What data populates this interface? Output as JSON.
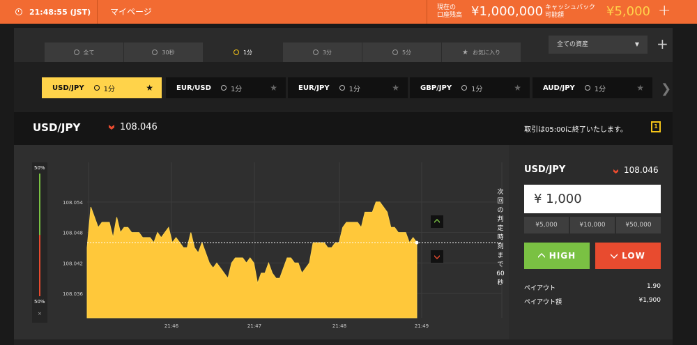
{
  "topbar": {
    "time": "21:48:55 (JST)",
    "mypage": "マイページ",
    "balance_label_line1": "現在の",
    "balance_label_line2": "口座残高",
    "balance_value": "¥1,000,000",
    "cashback_label_line1": "キャッシュバック",
    "cashback_label_line2": "可能額",
    "cashback_value": "¥5,000",
    "plus": "+"
  },
  "tabs": [
    {
      "label": "全て",
      "icon": "clock-icon"
    },
    {
      "label": "30秒",
      "icon": "clock-icon"
    },
    {
      "label": "1分",
      "icon": "clock-icon",
      "active": true
    },
    {
      "label": "3分",
      "icon": "clock-icon"
    },
    {
      "label": "5分",
      "icon": "clock-icon"
    },
    {
      "label": "お気に入り",
      "icon": "star-icon"
    }
  ],
  "asset_select": {
    "value": "全ての資産",
    "plus": "+"
  },
  "assets": [
    {
      "pair": "USD/JPY",
      "duration": "1分",
      "active": true
    },
    {
      "pair": "EUR/USD",
      "duration": "1分"
    },
    {
      "pair": "EUR/JPY",
      "duration": "1分"
    },
    {
      "pair": "GBP/JPY",
      "duration": "1分"
    },
    {
      "pair": "AUD/JPY",
      "duration": "1分"
    }
  ],
  "price_header": {
    "pair": "USD/JPY",
    "price": "108.046",
    "note": "取引は05:00に終了いたします。",
    "icon_label": "1"
  },
  "gauge": {
    "top": "50%",
    "bottom": "50%",
    "close": "×"
  },
  "chart_side_note": "次回の判定時刻まで60秒",
  "colors": {
    "accent": "#f26b32",
    "gold": "#ffd34a",
    "high": "#7ac143",
    "low": "#e84b2f"
  },
  "chart_data": {
    "type": "area",
    "y_ticks": [
      "108.054",
      "108.048",
      "108.042",
      "108.036"
    ],
    "x_ticks": [
      "21:46",
      "21:47",
      "21:48",
      "21:49"
    ],
    "ylim": [
      108.0312,
      108.0618
    ],
    "strike": 108.046,
    "series": [
      {
        "values": [
          108.045,
          108.053,
          108.051,
          108.049,
          108.05,
          108.05,
          108.05,
          108.047,
          108.051,
          108.048,
          108.049,
          108.049,
          108.048,
          108.048,
          108.048,
          108.047,
          108.047,
          108.047,
          108.046,
          108.048,
          108.047,
          108.048,
          108.049,
          108.046,
          108.047,
          108.046,
          108.045,
          108.045,
          108.048,
          108.045,
          108.044,
          108.046,
          108.044,
          108.042,
          108.041,
          108.042,
          108.041,
          108.04,
          108.039,
          108.042,
          108.043,
          108.043,
          108.043,
          108.042,
          108.043,
          108.042,
          108.038,
          108.04,
          108.04,
          108.042,
          108.04,
          108.039,
          108.039,
          108.041,
          108.043,
          108.043,
          108.042,
          108.042,
          108.04,
          108.041,
          108.042,
          108.046,
          108.046,
          108.046,
          108.046,
          108.045,
          108.045,
          108.046,
          108.046,
          108.049,
          108.05,
          108.05,
          108.05,
          108.05,
          108.049,
          108.052,
          108.052,
          108.052,
          108.054,
          108.054,
          108.053,
          108.052,
          108.049,
          108.049,
          108.048,
          108.048,
          108.048,
          108.046,
          108.047,
          108.046
        ]
      }
    ]
  },
  "trade": {
    "pair": "USD/JPY",
    "price": "108.046",
    "amount": "¥ 1,000",
    "presets": [
      "¥5,000",
      "¥10,000",
      "¥50,000"
    ],
    "high": "HIGH",
    "low": "LOW",
    "payout_label": "ペイアウト",
    "payout_value": "1.90",
    "payout_amount_label": "ペイアウト額",
    "payout_amount_value": "¥1,900"
  }
}
